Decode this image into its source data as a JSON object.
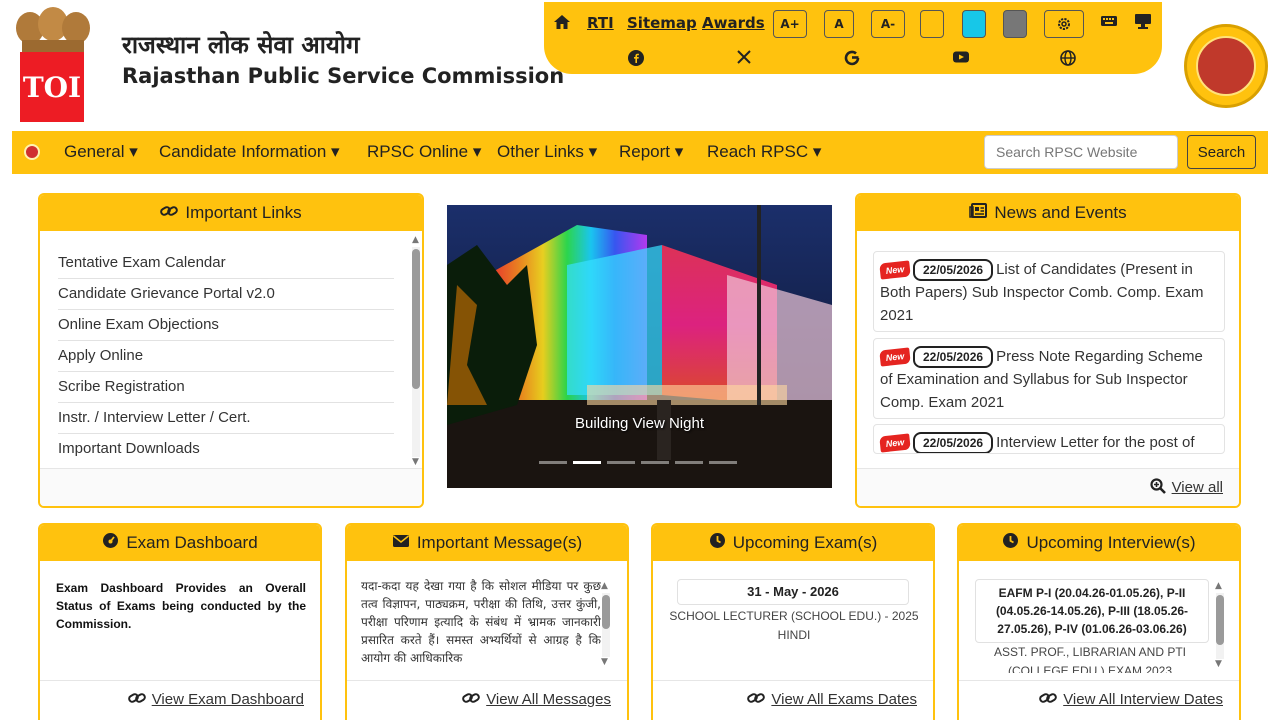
{
  "header": {
    "toi_badge": "TOI",
    "title_hindi": "राजस्थान लोक सेवा आयोग",
    "title_en": "Rajasthan Public Service Commission"
  },
  "topbar": {
    "rti": "RTI",
    "sitemap": "Sitemap",
    "awards": "Awards",
    "font_increase": "A+",
    "font_normal": "A",
    "font_decrease": "A-",
    "theme_colors": [
      "#ffc20e",
      "#17c7e8",
      "#777777"
    ]
  },
  "nav": {
    "items": [
      {
        "label": "General"
      },
      {
        "label": "Candidate Information"
      },
      {
        "label": "RPSC Online"
      },
      {
        "label": "Other Links"
      },
      {
        "label": "Report"
      },
      {
        "label": "Reach RPSC"
      }
    ],
    "search_placeholder": "Search RPSC Website",
    "search_button": "Search"
  },
  "important_links": {
    "title": "Important Links",
    "items": [
      "Tentative Exam Calendar",
      "Candidate Grievance Portal v2.0",
      "Online Exam Objections",
      "Apply Online",
      "Scribe Registration",
      "Instr. / Interview Letter / Cert.",
      "Important Downloads"
    ]
  },
  "carousel": {
    "caption": "Building View Night",
    "slides": 6,
    "active_slide": 2
  },
  "news": {
    "title": "News and Events",
    "new_badge": "New",
    "items": [
      {
        "date": "22/05/2026",
        "text": "List of Candidates (Present in Both Papers) Sub Inspector Comb. Comp. Exam 2021"
      },
      {
        "date": "22/05/2026",
        "text": "Press Note Regarding Scheme of Examination and Syllabus for Sub Inspector Comp. Exam 2021"
      },
      {
        "date": "22/05/2026",
        "text": "Interview Letter for the post of"
      }
    ],
    "view_all": "View all"
  },
  "exam_dashboard": {
    "title": "Exam Dashboard",
    "text": "Exam Dashboard Provides an Overall Status of Exams being conducted by the Commission.",
    "link": "View Exam Dashboard"
  },
  "important_messages": {
    "title": "Important Message(s)",
    "text": "यदा-कदा यह देखा गया है कि सोशल मीडिया पर कुछ तत्व विज्ञापन, पाठ्यक्रम, परीक्षा की तिथि, उत्तर कुंजी, परीक्षा परिणाम इत्यादि के संबंध में भ्रामक जानकारी प्रसारित करते हैं। समस्त अभ्यर्थियों से आग्रह है कि आयोग की आधिकारिक",
    "link": "View All Messages"
  },
  "upcoming_exams": {
    "title": "Upcoming Exam(s)",
    "date": "31 - May - 2026",
    "exam": "SCHOOL LECTURER (SCHOOL EDU.) - 2025 HINDI",
    "link": "View All Exams Dates"
  },
  "upcoming_interviews": {
    "title": "Upcoming Interview(s)",
    "schedule": "EAFM P-I (20.04.26-01.05.26), P-II (04.05.26-14.05.26), P-III (18.05.26-27.05.26), P-IV (01.06.26-03.06.26)",
    "post": "ASST. PROF., LIBRARIAN AND PTI (COLLEGE EDU.) EXAM 2023",
    "link": "View All Interview Dates"
  }
}
